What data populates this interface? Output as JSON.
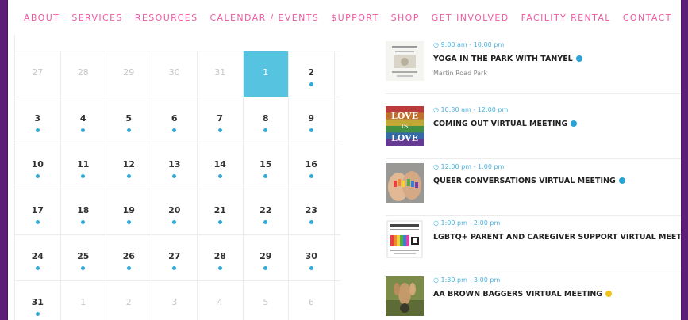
{
  "nav": [
    "ABOUT",
    "SERVICES",
    "RESOURCES",
    "CALENDAR / EVENTS",
    "$UPPORT",
    "SHOP",
    "GET INVOLVED",
    "FACILITY RENTAL",
    "CONTACT"
  ],
  "calendar": {
    "weeks": [
      [
        {
          "n": "27",
          "dim": true
        },
        {
          "n": "28",
          "dim": true
        },
        {
          "n": "29",
          "dim": true
        },
        {
          "n": "30",
          "dim": true
        },
        {
          "n": "31",
          "dim": true
        },
        {
          "n": "1",
          "today": true
        },
        {
          "n": "2",
          "dot": true
        }
      ],
      [
        {
          "n": "3",
          "dot": true
        },
        {
          "n": "4",
          "dot": true
        },
        {
          "n": "5",
          "dot": true
        },
        {
          "n": "6",
          "dot": true
        },
        {
          "n": "7",
          "dot": true
        },
        {
          "n": "8",
          "dot": true
        },
        {
          "n": "9",
          "dot": true
        }
      ],
      [
        {
          "n": "10",
          "dot": true
        },
        {
          "n": "11",
          "dot": true
        },
        {
          "n": "12",
          "dot": true
        },
        {
          "n": "13",
          "dot": true
        },
        {
          "n": "14",
          "dot": true
        },
        {
          "n": "15",
          "dot": true
        },
        {
          "n": "16",
          "dot": true
        }
      ],
      [
        {
          "n": "17",
          "dot": true
        },
        {
          "n": "18",
          "dot": true
        },
        {
          "n": "19",
          "dot": true
        },
        {
          "n": "20",
          "dot": true
        },
        {
          "n": "21",
          "dot": true
        },
        {
          "n": "22",
          "dot": true
        },
        {
          "n": "23",
          "dot": true
        }
      ],
      [
        {
          "n": "24",
          "dot": true
        },
        {
          "n": "25",
          "dot": true
        },
        {
          "n": "26",
          "dot": true
        },
        {
          "n": "27",
          "dot": true
        },
        {
          "n": "28",
          "dot": true
        },
        {
          "n": "29",
          "dot": true
        },
        {
          "n": "30",
          "dot": true
        }
      ],
      [
        {
          "n": "31",
          "dot": true
        },
        {
          "n": "1",
          "dim": true
        },
        {
          "n": "2",
          "dim": true
        },
        {
          "n": "3",
          "dim": true
        },
        {
          "n": "4",
          "dim": true
        },
        {
          "n": "5",
          "dim": true
        },
        {
          "n": "6",
          "dim": true
        }
      ]
    ]
  },
  "events": [
    {
      "time": "9:00 am - 10:00 pm",
      "title": "YOGA IN THE PARK WITH TANYEL",
      "location": "Martin Road Park",
      "dot_color": "#2aa4d8",
      "thumb": "flyer",
      "thumb_text": []
    },
    {
      "time": "10:30 am - 12:00 pm",
      "title": "COMING OUT VIRTUAL MEETING",
      "location": "",
      "dot_color": "#2aa4d8",
      "thumb": "love",
      "thumb_text": [
        "LOVE",
        "IS",
        "LOVE"
      ]
    },
    {
      "time": "12:00 pm - 1:00 pm",
      "title": "QUEER CONVERSATIONS VIRTUAL MEETING",
      "location": "",
      "dot_color": "#2aa4d8",
      "thumb": "hands",
      "thumb_text": []
    },
    {
      "time": "1:00 pm - 2:00 pm",
      "title": "LGBTQ+ PARENT AND CAREGIVER SUPPORT VIRTUAL MEETING",
      "location": "",
      "dot_color": "#2aa4d8",
      "thumb": "poster",
      "thumb_text": []
    },
    {
      "time": "1:30 pm - 3:00 pm",
      "title": "AA BROWN BAGGERS VIRTUAL MEETING",
      "location": "",
      "dot_color": "#f2c417",
      "thumb": "photo",
      "thumb_text": []
    }
  ]
}
